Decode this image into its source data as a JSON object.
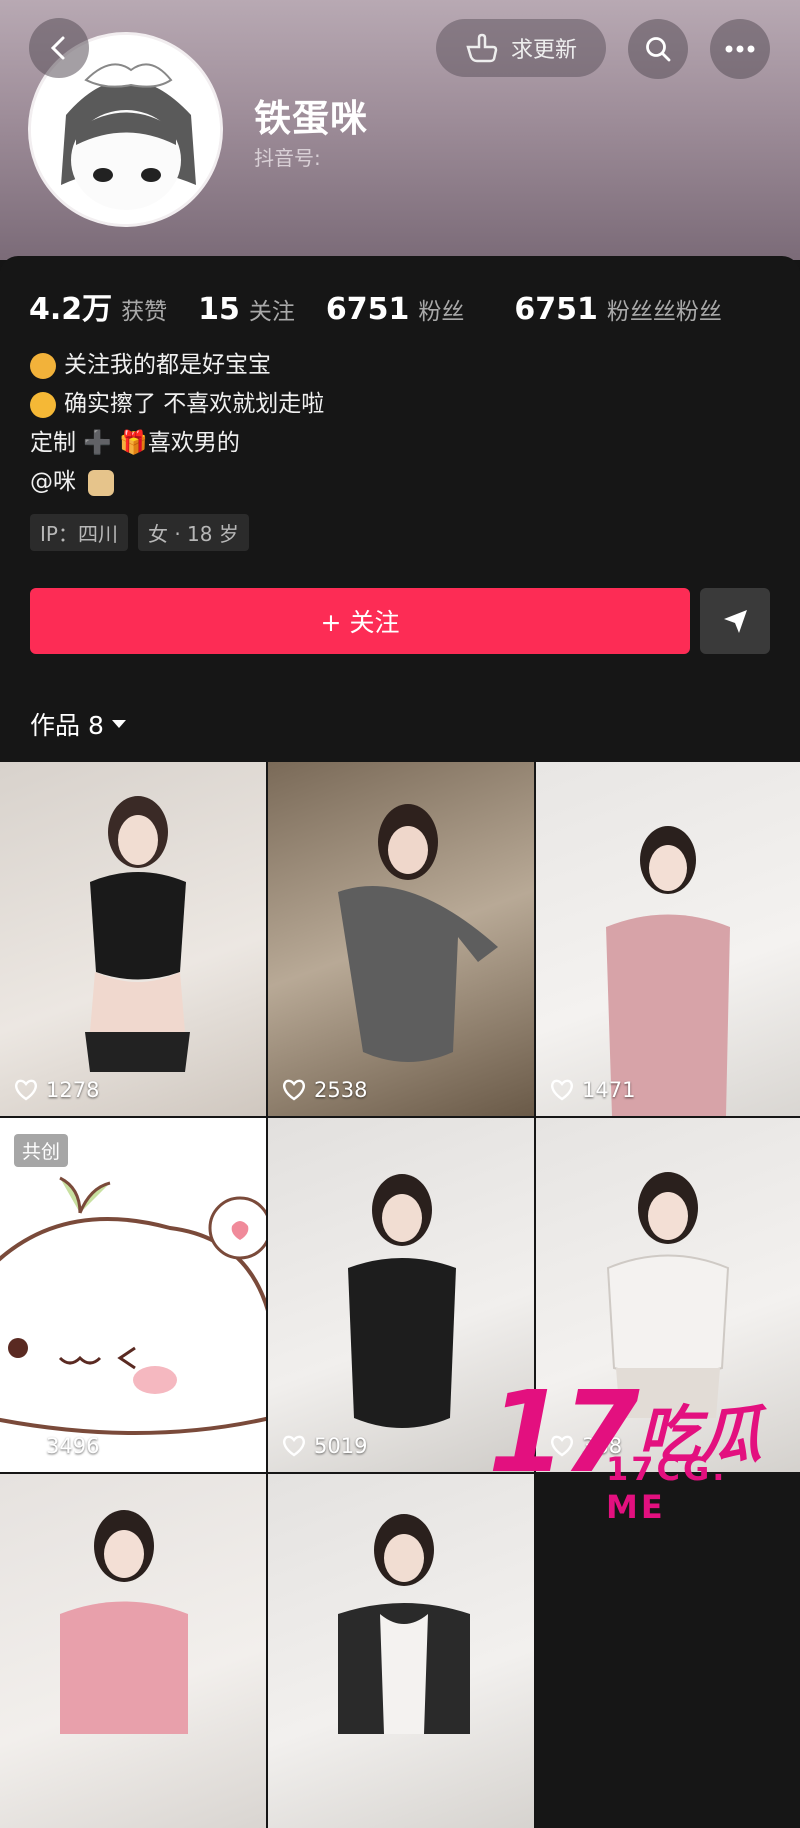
{
  "header": {
    "update_label": "求更新",
    "name": "铁蛋咪",
    "account_label": "抖音号:"
  },
  "stats": [
    {
      "value": "4.2万",
      "label": "获赞"
    },
    {
      "value": "15",
      "label": "关注"
    },
    {
      "value": "6751",
      "label": "粉丝"
    },
    {
      "value": "6751",
      "label": "粉丝丝粉丝"
    }
  ],
  "bio": [
    "关注我的都是好宝宝",
    "确实擦了 不喜欢就划走啦",
    "定制 ➕ 🎁喜欢男的",
    "@咪"
  ],
  "tags": [
    "IP：四川",
    "女 · 18 岁"
  ],
  "follow_label": "+ 关注",
  "works_label": "作品 8",
  "videos": [
    {
      "likes": "1278"
    },
    {
      "likes": "2538"
    },
    {
      "likes": "1471"
    },
    {
      "likes": "3496",
      "badge": "共创"
    },
    {
      "likes": "5019"
    },
    {
      "likes": "368"
    },
    {
      "likes": ""
    },
    {
      "likes": ""
    }
  ],
  "watermark": {
    "big": "17",
    "cn": "吃瓜",
    "url": "17CG. ME"
  },
  "colors": {
    "follow": "#fd2c55",
    "background": "#161616",
    "watermark": "#e3107f"
  }
}
